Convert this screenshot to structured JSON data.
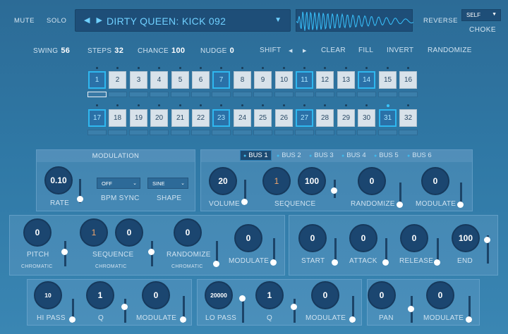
{
  "top": {
    "mute": "MUTE",
    "solo": "SOLO",
    "preset_arrows": "◀ ▶",
    "preset_name": "DIRTY QUEEN: KICK 092",
    "preset_caret": "▼",
    "reverse": "REVERSE",
    "self_select": "SELF",
    "choke": "CHOKE"
  },
  "params": {
    "swing_label": "SWING",
    "swing_value": "56",
    "steps_label": "STEPS",
    "steps_value": "32",
    "chance_label": "CHANCE",
    "chance_value": "100",
    "nudge_label": "NUDGE",
    "nudge_value": "0",
    "shift_label": "SHIFT",
    "shift_left": "◀",
    "shift_right": "▶",
    "clear": "CLEAR",
    "fill": "FILL",
    "invert": "INVERT",
    "randomize": "RANDOMIZE"
  },
  "steps": {
    "row1": [
      "1",
      "2",
      "3",
      "4",
      "5",
      "6",
      "7",
      "8",
      "9",
      "10",
      "11",
      "12",
      "13",
      "14",
      "15",
      "16"
    ],
    "row2": [
      "17",
      "18",
      "19",
      "20",
      "21",
      "22",
      "23",
      "24",
      "25",
      "26",
      "27",
      "28",
      "29",
      "30",
      "31",
      "32"
    ],
    "active": [
      1,
      7,
      11,
      14,
      17,
      23,
      27,
      31
    ]
  },
  "modulation": {
    "title": "MODULATION",
    "rate_value": "0.10",
    "rate_label": "RATE",
    "sync_value": "OFF",
    "sync_label": "BPM SYNC",
    "shape_value": "SINE",
    "shape_label": "SHAPE"
  },
  "buses": {
    "tabs": [
      "BUS 1",
      "BUS 2",
      "BUS 3",
      "BUS 4",
      "BUS 5",
      "BUS 6"
    ],
    "active": "BUS 1",
    "volume_value": "20",
    "volume_label": "VOLUME",
    "seq_value1": "1",
    "seq_value2": "100",
    "sequence_label": "SEQUENCE",
    "randomize_value": "0",
    "randomize_label": "RANDOMIZE",
    "modulate_value": "0",
    "modulate_label": "MODULATE"
  },
  "pitch": {
    "pitch_value": "0",
    "pitch_label": "PITCH",
    "pitch_sub": "CHROMATIC",
    "seq_value1": "1",
    "seq_value2": "0",
    "sequence_label": "SEQUENCE",
    "sequence_sub": "CHROMATIC",
    "randomize_value": "0",
    "randomize_label": "RANDOMIZE",
    "randomize_sub": "CHROMATIC",
    "modulate_value": "0",
    "modulate_label": "MODULATE"
  },
  "envelope": {
    "start_value": "0",
    "start_label": "START",
    "attack_value": "0",
    "attack_label": "ATTACK",
    "release_value": "0",
    "release_label": "RELEASE",
    "end_value": "100",
    "end_label": "END"
  },
  "hipass": {
    "freq_value": "10",
    "freq_label": "HI PASS",
    "q_value": "1",
    "q_label": "Q",
    "mod_value": "0",
    "mod_label": "MODULATE"
  },
  "lopass": {
    "freq_value": "20000",
    "freq_label": "LO PASS",
    "q_value": "1",
    "q_label": "Q",
    "mod_value": "0",
    "mod_label": "MODULATE"
  },
  "pan": {
    "pan_value": "0",
    "pan_label": "PAN",
    "mod_value": "0",
    "mod_label": "MODULATE"
  },
  "colors": {
    "accent": "#2fb7ef",
    "preset_text": "#6fd0ff",
    "sequence_orange": "#f2a56c"
  }
}
